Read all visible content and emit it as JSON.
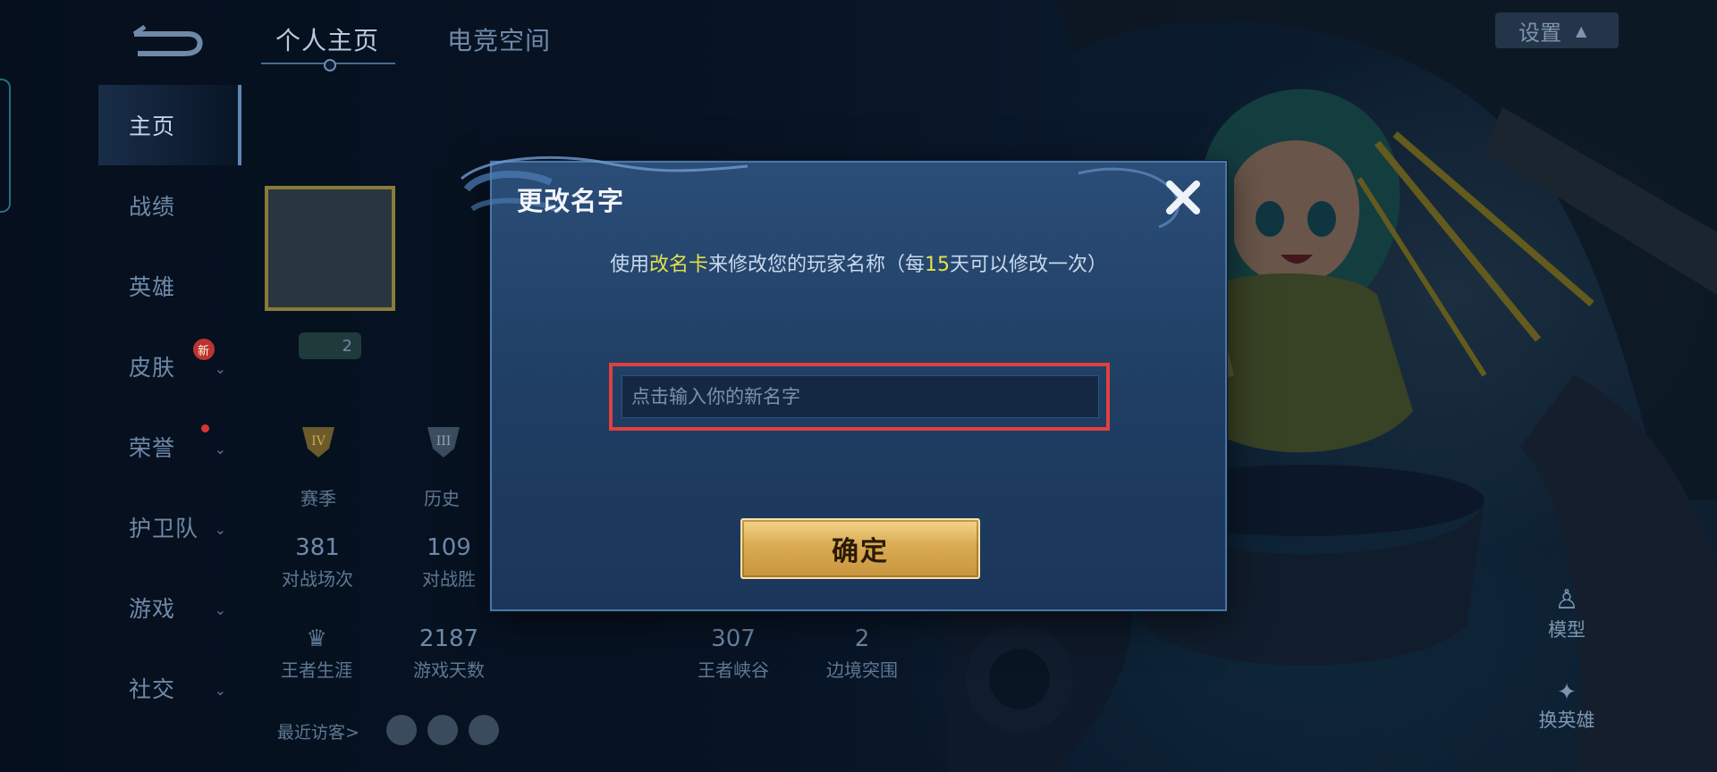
{
  "header": {
    "tabs": [
      {
        "label": "个人主页",
        "active": true
      },
      {
        "label": "电竞空间",
        "active": false
      }
    ],
    "settings_label": "设置"
  },
  "sidebar": {
    "items": [
      {
        "label": "主页",
        "active": true
      },
      {
        "label": "战绩"
      },
      {
        "label": "英雄"
      },
      {
        "label": "皮肤",
        "badge": "新"
      },
      {
        "label": "荣誉",
        "dot": true
      },
      {
        "label": "护卫队"
      },
      {
        "label": "游戏"
      },
      {
        "label": "社交"
      }
    ]
  },
  "profile": {
    "level_small": "2",
    "rank_labels": [
      "赛季",
      "历史"
    ],
    "stats": [
      {
        "value": "381",
        "label": "对战场次"
      },
      {
        "value": "109",
        "label": "对战胜"
      },
      {
        "value": "",
        "label": "王者生涯"
      },
      {
        "value": "2187",
        "label": "游戏天数"
      },
      {
        "value": "307",
        "label": "王者峡谷"
      },
      {
        "value": "2",
        "label": "边境突围"
      }
    ],
    "visitors_label": "最近访客>"
  },
  "right_buttons": {
    "model_label": "模型",
    "switch_hero_label": "换英雄"
  },
  "modal": {
    "title": "更改名字",
    "hint_prefix": "使用",
    "hint_card": "改名卡",
    "hint_mid": "来修改您的玩家名称（每",
    "hint_days": "15",
    "hint_suffix": "天可以修改一次）",
    "input_value": "",
    "input_placeholder": "点击输入你的新名字",
    "confirm_label": "确定"
  },
  "colors": {
    "highlight": "#e4e04a",
    "focus_outline": "#e0403f",
    "confirm_gold": "#d9ab52",
    "modal_bg": "#1f3d62"
  }
}
